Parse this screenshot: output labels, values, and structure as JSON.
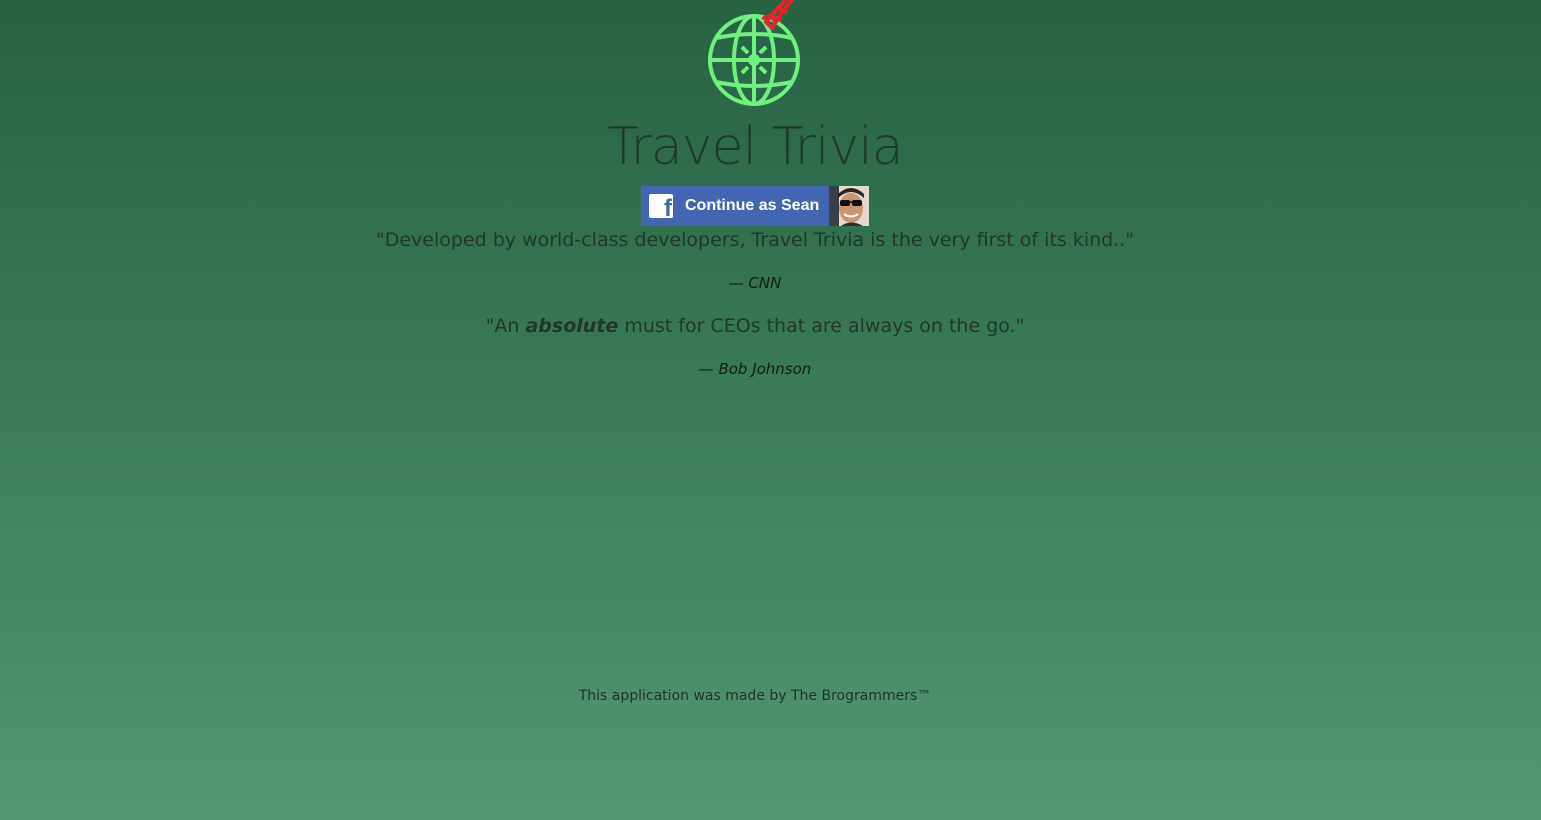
{
  "brand": {
    "logo_icon": "globe-with-eiffel-tower-icon",
    "globe_color": "#6ff07f",
    "tower_color": "#e3262b",
    "title": "Travel Trivia"
  },
  "login": {
    "label": "Continue as Sean",
    "fb_icon": "facebook-icon",
    "fb_glyph": "f",
    "button_color": "#4267b2"
  },
  "testimonials": [
    {
      "quote_start": "\"Developed by world-class developers, Travel Trivia is the very first of its kind..\"",
      "emphasis": "",
      "quote_end": "",
      "source": "— CNN"
    },
    {
      "quote_start": "\"An ",
      "emphasis": "absolute",
      "quote_end": " must for CEOs that are always on the go.\"",
      "source": "— Bob Johnson"
    }
  ],
  "footer": {
    "text": "This application was made by The Brogrammers™"
  },
  "colors": {
    "background_top": "#266343",
    "background_bottom": "#529774"
  }
}
